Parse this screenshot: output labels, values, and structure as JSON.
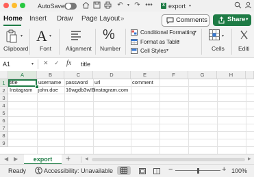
{
  "window": {
    "autosave_label": "AutoSave",
    "doc_badge": "X",
    "doc_title": "export"
  },
  "ribbon_tabs": [
    "Home",
    "Insert",
    "Draw",
    "Page Layout",
    "»"
  ],
  "buttons": {
    "comments": "Comments",
    "share": "Share"
  },
  "ribbon": {
    "clipboard": "Clipboard",
    "font": "Font",
    "font_glyph": "A",
    "alignment": "Alignment",
    "number": "Number",
    "number_glyph": "%",
    "conditional_formatting": "Conditional Formatting",
    "format_as_table": "Format as Table",
    "cell_styles": "Cell Styles",
    "cells": "Cells",
    "editing": "Editi"
  },
  "formula_bar": {
    "name_box": "A1",
    "fx": "fx",
    "content": "title"
  },
  "grid": {
    "columns": [
      "A",
      "B",
      "C",
      "D",
      "E",
      "F",
      "G",
      "H"
    ],
    "rows": [
      "1",
      "2",
      "3",
      "4",
      "5",
      "6",
      "7",
      "8",
      "9"
    ],
    "cells": {
      "A1": "title",
      "B1": "username",
      "C1": "password",
      "D1": "url",
      "E1": "comment",
      "A2": "Instagram",
      "B2": "john.doe",
      "C2": "16wgdb3w!B",
      "D2": "instagram.com"
    }
  },
  "sheet_tabs": {
    "active": "export",
    "add": "+"
  },
  "status": {
    "ready": "Ready",
    "accessibility": "Accessibility: Unavailable",
    "zoom_out": "−",
    "zoom_in": "+",
    "zoom": "100%"
  },
  "colors": {
    "accent": "#1e7b45",
    "selection": "#1e7b45"
  }
}
